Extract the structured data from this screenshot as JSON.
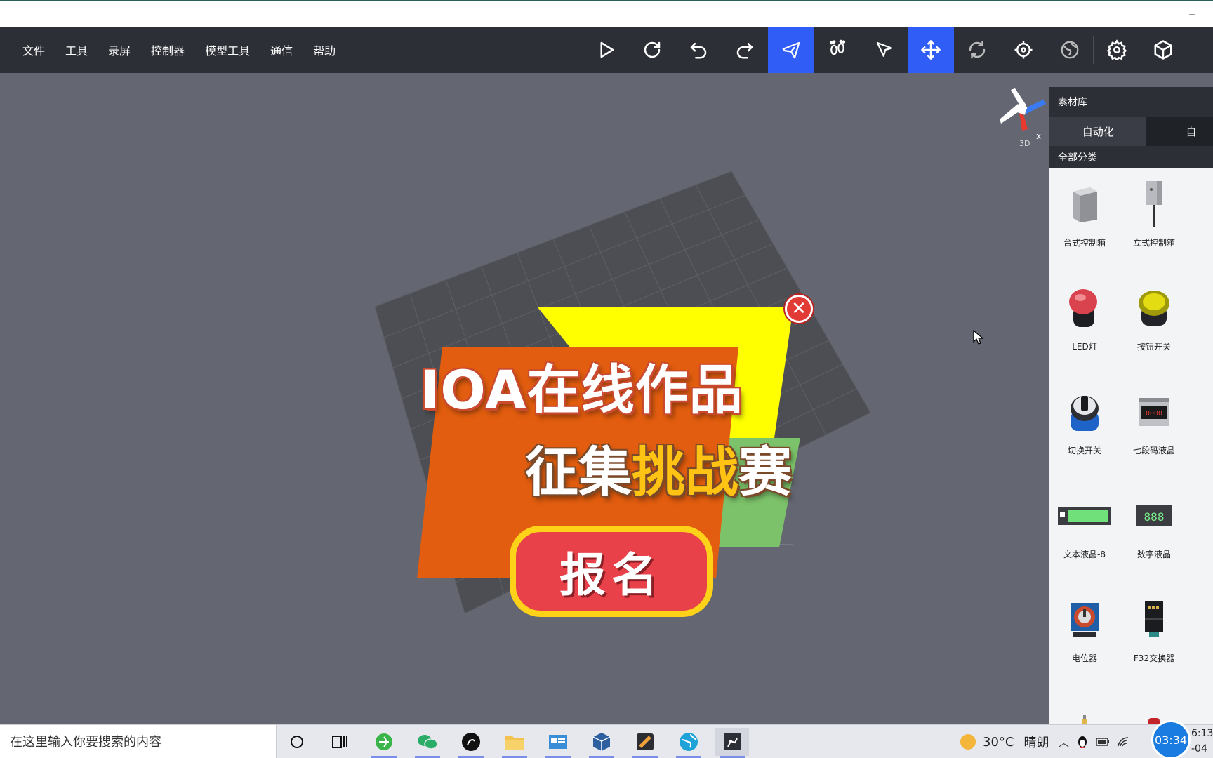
{
  "window": {
    "minimize": "–"
  },
  "menu": [
    "文件",
    "工具",
    "录屏",
    "控制器",
    "模型工具",
    "通信",
    "帮助"
  ],
  "toolbar": [
    {
      "icon": "play-icon",
      "active": false
    },
    {
      "icon": "refresh-icon",
      "active": false
    },
    {
      "icon": "undo-icon",
      "active": false
    },
    {
      "icon": "redo-icon",
      "active": false
    },
    {
      "icon": "plane-icon",
      "active": true
    },
    {
      "icon": "footprints-icon",
      "active": false
    },
    {
      "icon": "pointer-icon",
      "active": false
    },
    {
      "icon": "move-icon",
      "active": true
    },
    {
      "icon": "rotate-icon",
      "active": false
    },
    {
      "icon": "crosshair-icon",
      "active": false
    },
    {
      "icon": "globe-icon",
      "active": false
    },
    {
      "icon": "gear-icon",
      "active": false
    },
    {
      "icon": "cube-icon",
      "active": false
    }
  ],
  "viewport": {
    "gizmo_label": "3D",
    "gizmo_axis": "x"
  },
  "promo": {
    "line1": "IOA在线作品",
    "line2_pre": "征集",
    "line2_highlight": "挑战",
    "line2_post": "赛",
    "signup": "报名",
    "close": "✕"
  },
  "panel": {
    "title": "素材库",
    "tabs": [
      "自动化",
      "自"
    ],
    "category": "全部分类",
    "items": [
      {
        "label": "台式控制箱",
        "icon": "desk-box-icon"
      },
      {
        "label": "立式控制箱",
        "icon": "standing-box-icon"
      },
      {
        "label": "LED灯",
        "icon": "led-light-icon"
      },
      {
        "label": "按钮开关",
        "icon": "push-button-icon"
      },
      {
        "label": "切换开关",
        "icon": "selector-switch-icon"
      },
      {
        "label": "七段码液晶",
        "icon": "seven-segment-icon"
      },
      {
        "label": "文本液晶-8",
        "icon": "text-lcd-icon"
      },
      {
        "label": "数字液晶",
        "icon": "digital-lcd-icon"
      },
      {
        "label": "电位器",
        "icon": "potentiometer-icon"
      },
      {
        "label": "F32交换器",
        "icon": "f32-switch-icon"
      }
    ],
    "seven_segment_text": "0000",
    "digital_lcd_text": "888"
  },
  "taskbar": {
    "search_placeholder": "在这里输入你要搜索的内容",
    "temperature": "30°C",
    "condition": "晴朗",
    "clock_badge": "03:34",
    "time": "6:13",
    "date": "-04"
  }
}
